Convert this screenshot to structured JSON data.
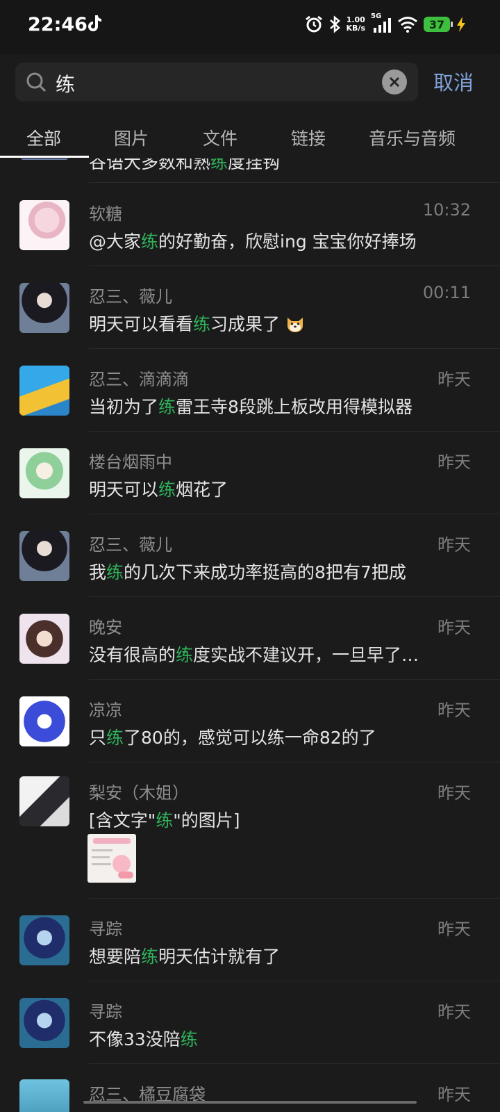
{
  "status_bar": {
    "time": "22:46",
    "net_speed_value": "1.00",
    "net_speed_unit": "KB/s",
    "network": "5G",
    "battery": "37"
  },
  "search": {
    "query": "练",
    "cancel_label": "取消"
  },
  "tabs": [
    "全部",
    "图片",
    "文件",
    "链接",
    "音乐与音频"
  ],
  "highlight_color": "#2fb25a",
  "partial_top": {
    "pre": "谷语大多数和熟",
    "hl": "练",
    "post": "度挂钩"
  },
  "results": [
    {
      "name": "软糖",
      "time": "10:32",
      "pre": "@大家",
      "hl": "练",
      "post": "的好勤奋，欣慰ing 宝宝你好捧场",
      "emoji": ""
    },
    {
      "name": "忍三、薇儿",
      "time": "00:11",
      "pre": "明天可以看看",
      "hl": "练",
      "post": "习成果了",
      "emoji": "dog-emoji"
    },
    {
      "name": "忍三、滴滴滴",
      "time": "昨天",
      "pre": "当初为了",
      "hl": "练",
      "post": "雷王寺8段跳上板改用得模拟器",
      "emoji": ""
    },
    {
      "name": "楼台烟雨中",
      "time": "昨天",
      "pre": "明天可以",
      "hl": "练",
      "post": "烟花了",
      "emoji": ""
    },
    {
      "name": "忍三、薇儿",
      "time": "昨天",
      "pre": "我",
      "hl": "练",
      "post": "的几次下来成功率挺高的8把有7把成",
      "emoji": ""
    },
    {
      "name": "晚安",
      "time": "昨天",
      "pre": "没有很高的",
      "hl": "练",
      "post": "度实战不建议开，一旦早了…",
      "emoji": ""
    },
    {
      "name": "凉凉",
      "time": "昨天",
      "pre": "只",
      "hl": "练",
      "post": "了80的，感觉可以练一命82的了",
      "emoji": ""
    },
    {
      "name": "梨安（木姐）",
      "time": "昨天",
      "pre": "[含文字\"",
      "hl": "练",
      "post": "\"的图片]",
      "emoji": ""
    },
    {
      "name": "寻踪",
      "time": "昨天",
      "pre": "想要陪",
      "hl": "练",
      "post": "明天估计就有了",
      "emoji": ""
    },
    {
      "name": "寻踪",
      "time": "昨天",
      "pre": "不像33没陪",
      "hl": "练",
      "post": "",
      "emoji": ""
    }
  ],
  "partial_bottom": {
    "name": "忍三、橘豆腐袋",
    "time": "昨天"
  }
}
